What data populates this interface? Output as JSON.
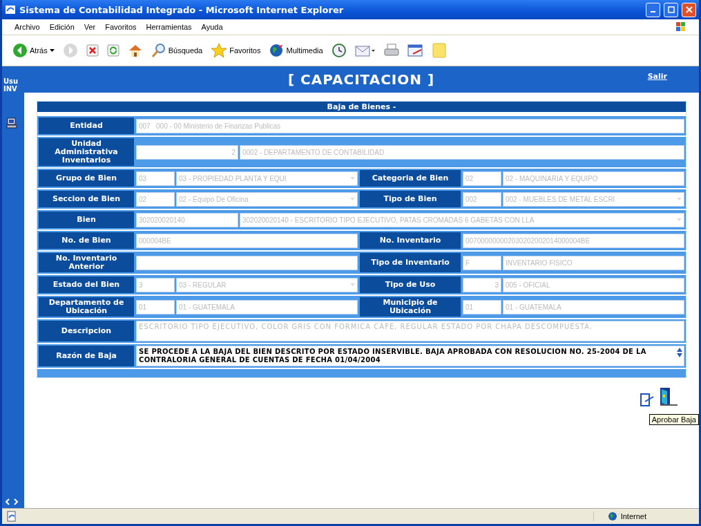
{
  "window": {
    "title": "Sistema de Contabilidad Integrado - Microsoft Internet Explorer"
  },
  "menu": [
    "Archivo",
    "Edición",
    "Ver",
    "Favoritos",
    "Herramientas",
    "Ayuda"
  ],
  "toolbar": [
    {
      "kind": "back",
      "label": "Atrás"
    },
    {
      "kind": "forward"
    },
    {
      "kind": "stop"
    },
    {
      "kind": "refresh"
    },
    {
      "kind": "home"
    },
    {
      "kind": "search",
      "label": "Búsqueda"
    },
    {
      "kind": "favorites",
      "label": "Favoritos"
    },
    {
      "kind": "media",
      "label": "Multimedia"
    },
    {
      "kind": "history"
    },
    {
      "kind": "mail"
    },
    {
      "kind": "print"
    },
    {
      "kind": "edit"
    },
    {
      "kind": "note"
    }
  ],
  "header": {
    "title": "[ CAPACITACION ]",
    "link": "Salir"
  },
  "sidebar": {
    "texts": [
      "Usu",
      "INV"
    ]
  },
  "form": {
    "title": "Baja de Bienes -",
    "rows": [
      {
        "fields": [
          {
            "label": "Entidad",
            "inputs": [
              {
                "kind": "text",
                "value": "007   000 - 00 Ministerio de Finanzas Publicas",
                "disabled": true
              }
            ]
          }
        ]
      },
      {
        "fields": [
          {
            "label": "Unidad Administrativa Inventarios",
            "inputs": [
              {
                "kind": "text",
                "value": "2",
                "disabled": true,
                "right_aligned": true
              },
              {
                "kind": "text",
                "value": "0002 - DEPARTAMENTO DE CONTABILIDAD",
                "disabled": true
              }
            ]
          }
        ]
      },
      {
        "fields": [
          {
            "label": "Grupo de Bien",
            "inputs": [
              {
                "kind": "text",
                "value": "03",
                "disabled": true
              },
              {
                "kind": "select",
                "value": "03 - PROPIEDAD PLANTA Y EQUI",
                "disabled": true
              }
            ]
          },
          {
            "label": "Categoria de Bien",
            "inputs": [
              {
                "kind": "text",
                "value": "02",
                "disabled": true
              },
              {
                "kind": "text",
                "value": "02 - MAQUINARIA Y EQUIPO",
                "disabled": true
              }
            ]
          }
        ]
      },
      {
        "fields": [
          {
            "label": "Seccion de Bien",
            "inputs": [
              {
                "kind": "text",
                "value": "02",
                "disabled": true
              },
              {
                "kind": "select",
                "value": "02 - Equipo De Oficina",
                "disabled": true
              }
            ]
          },
          {
            "label": "Tipo de Bien",
            "inputs": [
              {
                "kind": "text",
                "value": "002",
                "disabled": true
              },
              {
                "kind": "select",
                "value": "002 - MUEBLES DE METAL ESCRI",
                "disabled": true
              }
            ]
          }
        ]
      },
      {
        "fields": [
          {
            "label": "Bien",
            "inputs": [
              {
                "kind": "text",
                "value": "302020020140",
                "disabled": true
              },
              {
                "kind": "select",
                "value": "302020020140 - ESCRITORIO TIPO EJECUTIVO, PATAS CROMADAS 6 GABETAS CON LLA",
                "disabled": true
              }
            ]
          }
        ]
      },
      {
        "fields": [
          {
            "label": "No. de Bien",
            "inputs": [
              {
                "kind": "text",
                "value": "000004BE",
                "disabled": true
              }
            ]
          },
          {
            "label": "No. Inventario",
            "inputs": [
              {
                "kind": "text",
                "value": "007000000002030202002014000004BE",
                "disabled": true
              }
            ]
          }
        ]
      },
      {
        "fields": [
          {
            "label": "No. Inventario Anterior",
            "inputs": [
              {
                "kind": "text"
              }
            ]
          },
          {
            "label": "Tipo de Inventario",
            "inputs": [
              {
                "kind": "text",
                "value": "F",
                "disabled": true
              },
              {
                "kind": "text",
                "value": "INVENTARIO FISICO",
                "disabled": true
              }
            ]
          }
        ]
      },
      {
        "fields": [
          {
            "label": "Estado del Bien",
            "inputs": [
              {
                "kind": "text",
                "value": "3",
                "disabled": true
              },
              {
                "kind": "select",
                "value": "03 - REGULAR",
                "disabled": true
              }
            ]
          },
          {
            "label": "Tipo de Uso",
            "inputs": [
              {
                "kind": "text",
                "value": "3",
                "disabled": true,
                "right_aligned": true
              },
              {
                "kind": "text",
                "value": "005 - OFICIAL",
                "disabled": true
              }
            ]
          }
        ]
      },
      {
        "fields": [
          {
            "label": "Departamento de Ubicación",
            "inputs": [
              {
                "kind": "text",
                "value": "01",
                "disabled": true
              },
              {
                "kind": "text",
                "value": "01 - GUATEMALA",
                "disabled": true
              }
            ]
          },
          {
            "label": "Municipio de Ubicación",
            "inputs": [
              {
                "kind": "text",
                "value": "01",
                "disabled": true
              },
              {
                "kind": "text",
                "value": "01 - GUATEMALA",
                "disabled": true
              }
            ]
          }
        ]
      },
      {
        "fields": [
          {
            "label": "Descripcion",
            "inputs": [
              {
                "kind": "textarea",
                "value": "ESCRITORIO TIPO EJECUTIVO, COLOR GRIS CON FORMICA CAFE,  REGULAR ESTADO POR CHAPA DESCOMPUESTA.",
                "disabled": true
              }
            ]
          }
        ]
      },
      {
        "fields": [
          {
            "label": "Razón de Baja",
            "inputs": [
              {
                "kind": "textarea",
                "value": "SE PROCEDE A LA BAJA DEL BIEN DESCRITO POR ESTADO INSERVIBLE. BAJA APROBADA CON RESOLUCION NO. 25-2004 DE LA CONTRALORIA GENERAL DE CUENTAS DE FECHA 01/04/2004",
                "disabled": false
              }
            ]
          }
        ]
      }
    ]
  },
  "actions": [
    {
      "kind": "edit"
    },
    {
      "kind": "door"
    }
  ],
  "tooltip": "Aprobar Baja",
  "status_bar": {
    "zone": "Internet"
  }
}
